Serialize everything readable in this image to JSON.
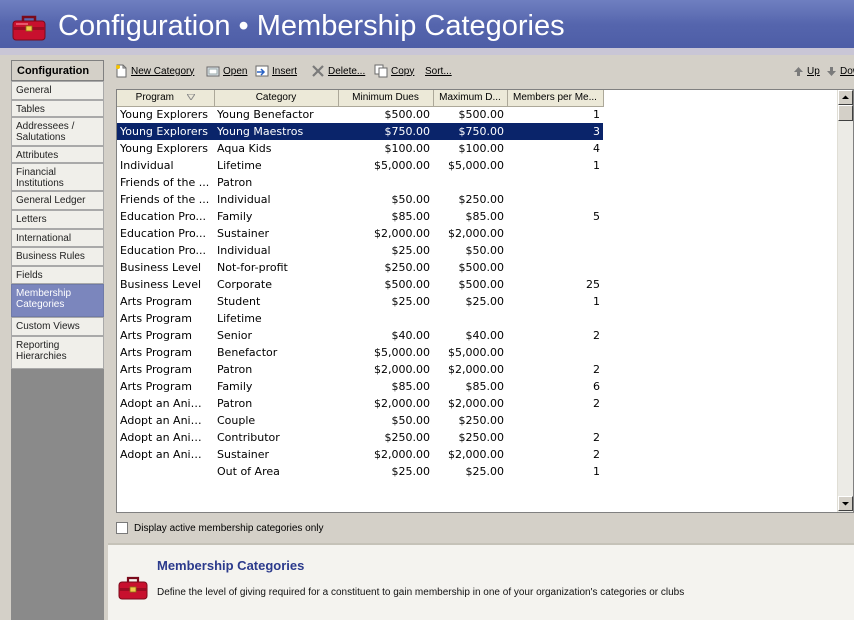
{
  "header": {
    "title": "Configuration • Membership Categories",
    "icon": "toolbox-icon"
  },
  "nav": {
    "heading": "Configuration",
    "items": [
      {
        "label": "General"
      },
      {
        "label": "Tables"
      },
      {
        "label": "Addressees / Salutations"
      },
      {
        "label": "Attributes"
      },
      {
        "label": "Financial Institutions"
      },
      {
        "label": "General Ledger"
      },
      {
        "label": "Letters"
      },
      {
        "label": "International"
      },
      {
        "label": "Business Rules"
      },
      {
        "label": "Fields"
      },
      {
        "label": "Membership Categories",
        "active": true
      },
      {
        "label": "Custom Views"
      },
      {
        "label": "Reporting Hierarchies"
      }
    ]
  },
  "toolbar": {
    "new_category": "New Category",
    "open": "Open",
    "insert": "Insert",
    "delete": "Delete...",
    "copy": "Copy",
    "sort": "Sort...",
    "up": "Up",
    "down": "Down"
  },
  "grid": {
    "columns": [
      "Program",
      "Category",
      "Minimum Dues",
      "Maximum D...",
      "Members per Me..."
    ],
    "selected_index": 1,
    "rows": [
      [
        "Young Explorers",
        "Young Benefactor",
        "$500.00",
        "$500.00",
        "1"
      ],
      [
        "Young Explorers",
        "Young Maestros",
        "$750.00",
        "$750.00",
        "3"
      ],
      [
        "Young Explorers",
        "Aqua Kids",
        "$100.00",
        "$100.00",
        "4"
      ],
      [
        "Individual",
        "Lifetime",
        "$5,000.00",
        "$5,000.00",
        "1"
      ],
      [
        "Friends of the ...",
        "Patron",
        "",
        "",
        ""
      ],
      [
        "Friends of the ...",
        "Individual",
        "$50.00",
        "$250.00",
        ""
      ],
      [
        "Education Pro...",
        "Family",
        "$85.00",
        "$85.00",
        "5"
      ],
      [
        "Education Pro...",
        "Sustainer",
        "$2,000.00",
        "$2,000.00",
        ""
      ],
      [
        "Education Pro...",
        "Individual",
        "$25.00",
        "$50.00",
        ""
      ],
      [
        "Business Level",
        "Not-for-profit",
        "$250.00",
        "$500.00",
        ""
      ],
      [
        "Business Level",
        "Corporate",
        "$500.00",
        "$500.00",
        "25"
      ],
      [
        "Arts Program",
        "Student",
        "$25.00",
        "$25.00",
        "1"
      ],
      [
        "Arts Program",
        "Lifetime",
        "",
        "",
        ""
      ],
      [
        "Arts Program",
        "Senior",
        "$40.00",
        "$40.00",
        "2"
      ],
      [
        "Arts Program",
        "Benefactor",
        "$5,000.00",
        "$5,000.00",
        ""
      ],
      [
        "Arts Program",
        "Patron",
        "$2,000.00",
        "$2,000.00",
        "2"
      ],
      [
        "Arts Program",
        "Family",
        "$85.00",
        "$85.00",
        "6"
      ],
      [
        "Adopt an Animal",
        "Patron",
        "$2,000.00",
        "$2,000.00",
        "2"
      ],
      [
        "Adopt an Animal",
        "Couple",
        "$50.00",
        "$250.00",
        ""
      ],
      [
        "Adopt an Animal",
        "Contributor",
        "$250.00",
        "$250.00",
        "2"
      ],
      [
        "Adopt an Animal",
        "Sustainer",
        "$2,000.00",
        "$2,000.00",
        "2"
      ],
      [
        "",
        "Out of Area",
        "$25.00",
        "$25.00",
        "1"
      ]
    ]
  },
  "filter": {
    "label": "Display active membership categories only",
    "checked": false
  },
  "info": {
    "title": "Membership Categories",
    "description": "Define the level of giving required for a constituent to gain membership in one of your organization's categories or clubs"
  }
}
